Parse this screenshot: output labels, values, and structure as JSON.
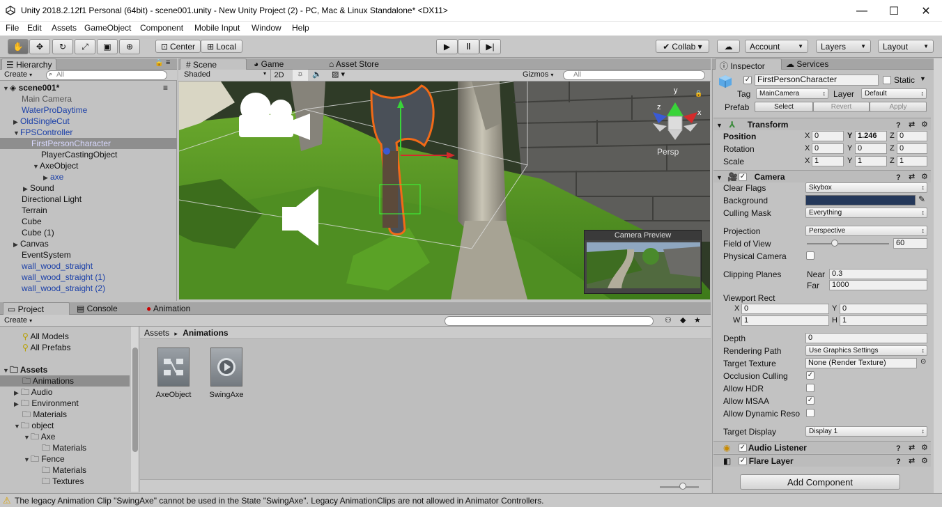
{
  "window": {
    "title": "Unity 2018.2.12f1 Personal (64bit) - scene001.unity - New Unity Project (2) - PC, Mac & Linux Standalone* <DX11>",
    "minimize_glyph": "—",
    "maximize_glyph": "☐",
    "close_glyph": "✕"
  },
  "menu": [
    "File",
    "Edit",
    "Assets",
    "GameObject",
    "Component",
    "Mobile Input",
    "Window",
    "Help"
  ],
  "toolbar": {
    "pivot": "Center",
    "space": "Local",
    "collab": "Collab ▾",
    "account": "Account",
    "layers": "Layers",
    "layout": "Layout"
  },
  "hierarchy": {
    "tab": "Hierarchy",
    "create": "Create",
    "search_placeholder": "All",
    "scene": "scene001*",
    "items": [
      {
        "label": "Main Camera",
        "color": "gray"
      },
      {
        "label": "WaterProDaytime",
        "color": "blue"
      },
      {
        "label": "OldSingleCut",
        "color": "blue"
      },
      {
        "label": "FPSController",
        "color": "blue"
      },
      {
        "label": "FirstPersonCharacter",
        "color": "blue"
      },
      {
        "label": "PlayerCastingObject",
        "color": "black"
      },
      {
        "label": "AxeObject",
        "color": "black"
      },
      {
        "label": "axe",
        "color": "blue"
      },
      {
        "label": "Sound",
        "color": "black"
      },
      {
        "label": "Directional Light",
        "color": "black"
      },
      {
        "label": "Terrain",
        "color": "black"
      },
      {
        "label": "Cube",
        "color": "black"
      },
      {
        "label": "Cube (1)",
        "color": "black"
      },
      {
        "label": "Canvas",
        "color": "black"
      },
      {
        "label": "EventSystem",
        "color": "black"
      },
      {
        "label": "wall_wood_straight",
        "color": "blue"
      },
      {
        "label": "wall_wood_straight (1)",
        "color": "blue"
      },
      {
        "label": "wall_wood_straight (2)",
        "color": "blue"
      }
    ]
  },
  "scene_view": {
    "tabs": [
      "Scene",
      "Game",
      "Asset Store"
    ],
    "shading": "Shaded",
    "mode_2d": "2D",
    "gizmos": "Gizmos",
    "search_placeholder": "All",
    "persp": "Persp",
    "camera_preview": "Camera Preview",
    "gizmo_axis_x": "x",
    "gizmo_axis_y": "y",
    "gizmo_axis_z": "z"
  },
  "project": {
    "tabs": [
      "Project",
      "Console",
      "Animation"
    ],
    "create": "Create",
    "favorites": [
      "All Models",
      "All Prefabs"
    ],
    "tree": [
      {
        "label": "Assets",
        "bold": true
      },
      {
        "label": "Animations",
        "selected": true
      },
      {
        "label": "Audio"
      },
      {
        "label": "Environment"
      },
      {
        "label": "Materials"
      },
      {
        "label": "object"
      },
      {
        "label": "Axe"
      },
      {
        "label": "Materials"
      },
      {
        "label": "Fence"
      },
      {
        "label": "Materials"
      },
      {
        "label": "Textures"
      }
    ],
    "breadcrumb_root": "Assets",
    "breadcrumb_sep": "▸",
    "breadcrumb_current": "Animations",
    "assets": [
      "AxeObject",
      "SwingAxe"
    ]
  },
  "inspector": {
    "tabs": [
      "Inspector",
      "Services"
    ],
    "object_name": "FirstPersonCharacter",
    "static_label": "Static",
    "tag_label": "Tag",
    "tag_value": "MainCamera",
    "layer_label": "Layer",
    "layer_value": "Default",
    "prefab_label": "Prefab",
    "prefab_buttons": [
      "Select",
      "Revert",
      "Apply"
    ],
    "transform": {
      "title": "Transform",
      "rows": [
        {
          "label": "Position",
          "x": "0",
          "y": "1.246",
          "z": "0"
        },
        {
          "label": "Rotation",
          "x": "0",
          "y": "0",
          "z": "0"
        },
        {
          "label": "Scale",
          "x": "1",
          "y": "1",
          "z": "1"
        }
      ]
    },
    "camera": {
      "title": "Camera",
      "clear_flags_label": "Clear Flags",
      "clear_flags": "Skybox",
      "background_label": "Background",
      "background_color": "#24385a",
      "culling_mask_label": "Culling Mask",
      "culling_mask": "Everything",
      "projection_label": "Projection",
      "projection": "Perspective",
      "fov_label": "Field of View",
      "fov": "60",
      "physical_label": "Physical Camera",
      "clipping_label": "Clipping Planes",
      "near_label": "Near",
      "near": "0.3",
      "far_label": "Far",
      "far": "1000",
      "viewport_label": "Viewport Rect",
      "vx": "0",
      "vy": "0",
      "vw": "1",
      "vh": "1",
      "depth_label": "Depth",
      "depth": "0",
      "rendering_path_label": "Rendering Path",
      "rendering_path": "Use Graphics Settings",
      "target_texture_label": "Target Texture",
      "target_texture": "None (Render Texture)",
      "occlusion_label": "Occlusion Culling",
      "hdr_label": "Allow HDR",
      "msaa_label": "Allow MSAA",
      "dynres_label": "Allow Dynamic Reso",
      "target_display_label": "Target Display",
      "target_display": "Display 1"
    },
    "audio_listener": "Audio Listener",
    "flare_layer": "Flare Layer",
    "add_component": "Add Component"
  },
  "status": {
    "message": "The legacy Animation Clip \"SwingAxe\" cannot be used in the State \"SwingAxe\". Legacy AnimationClips are not allowed in Animator Controllers."
  }
}
